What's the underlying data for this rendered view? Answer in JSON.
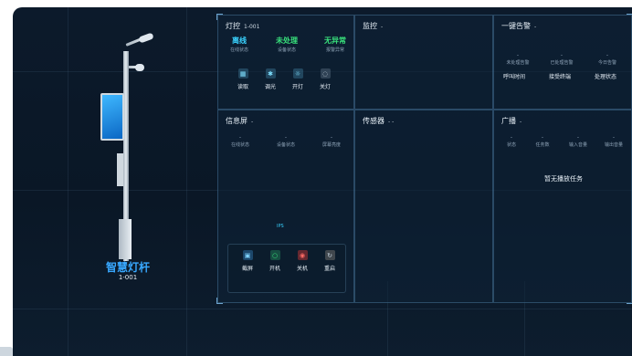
{
  "pole": {
    "title": "智慧灯杆",
    "id": "1-001"
  },
  "light_control": {
    "title": "灯控",
    "subtitle": "1-001",
    "stats": [
      {
        "value": "离线",
        "label": "在线状态",
        "color": "#3ad3ff"
      },
      {
        "value": "未处理",
        "label": "设备状态",
        "color": "#38e07b"
      },
      {
        "value": "无异常",
        "label": "报警异常",
        "color": "#38e07b"
      }
    ],
    "buttons": [
      {
        "label": "读取",
        "icon": "read-icon"
      },
      {
        "label": "调光",
        "icon": "dim-icon"
      },
      {
        "label": "开灯",
        "icon": "light-on-icon"
      },
      {
        "label": "关灯",
        "icon": "light-off-icon"
      }
    ]
  },
  "monitor": {
    "title": "监控",
    "suffix": "-"
  },
  "alarm": {
    "title": "一键告警",
    "suffix": "-",
    "stats": [
      {
        "value": "-",
        "label": "未处理告警"
      },
      {
        "value": "-",
        "label": "已处理告警"
      },
      {
        "value": "-",
        "label": "今日告警"
      }
    ],
    "actions": [
      "呼叫时间",
      "接受终端",
      "处理状态"
    ]
  },
  "info_screen": {
    "title": "信息屏",
    "suffix": "-",
    "stats": [
      {
        "value": "-",
        "label": "在线状态"
      },
      {
        "value": "-",
        "label": "设备状态"
      },
      {
        "value": "-",
        "label": "屏幕亮度"
      }
    ],
    "preview_caption": "IPS",
    "buttons": [
      {
        "label": "截屏",
        "icon": "screenshot-icon"
      },
      {
        "label": "开机",
        "icon": "power-on-icon"
      },
      {
        "label": "关机",
        "icon": "power-off-icon"
      },
      {
        "label": "重启",
        "icon": "restart-icon"
      }
    ]
  },
  "sensor": {
    "title": "传感器",
    "suffix": "- -"
  },
  "broadcast": {
    "title": "广播",
    "suffix": "-",
    "stats": [
      {
        "value": "-",
        "label": "状态"
      },
      {
        "value": "-",
        "label": "任务数"
      },
      {
        "value": "-",
        "label": "输入音量"
      },
      {
        "value": "-",
        "label": "输出音量"
      }
    ],
    "empty_text": "暂无播放任务"
  },
  "colors": {
    "accent": "#3ad3ff",
    "ok": "#38e07b",
    "danger": "#e0524f",
    "panel_border": "#4f82aa"
  }
}
